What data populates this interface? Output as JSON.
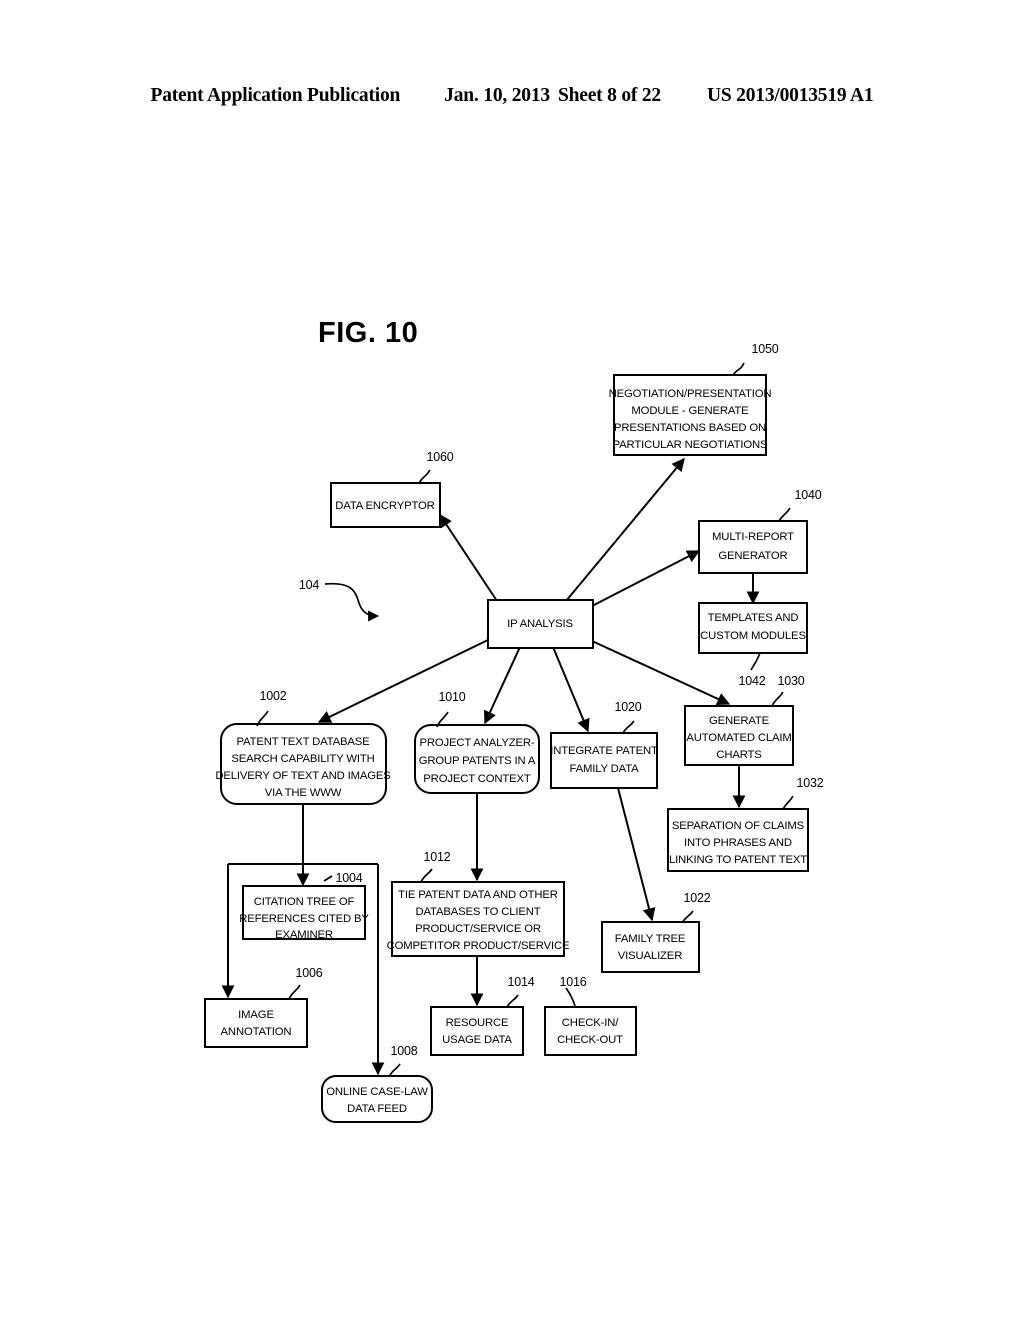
{
  "header": {
    "publication": "Patent Application Publication",
    "date": "Jan. 10, 2013",
    "sheet": "Sheet 8 of 22",
    "patent_number": "US 2013/0013519 A1"
  },
  "figure": {
    "title": "FIG. 10",
    "system_ref": "104"
  },
  "nodes": {
    "ip_analysis": {
      "ref": "",
      "label": "IP ANALYSIS",
      "shape": "rect"
    },
    "negotiation_module": {
      "ref": "1050",
      "label": "NEGOTIATION/PRESENTATION MODULE - GENERATE PRESENTATIONS BASED ON PARTICULAR NEGOTIATIONS",
      "shape": "rect",
      "lines": [
        "NEGOTIATION/PRESENTATION",
        "MODULE - GENERATE",
        "PRESENTATIONS BASED ON",
        "PARTICULAR NEGOTIATIONS"
      ]
    },
    "data_encryptor": {
      "ref": "1060",
      "label": "DATA ENCRYPTOR",
      "shape": "rect",
      "lines": [
        "DATA ENCRYPTOR"
      ]
    },
    "multi_report": {
      "ref": "1040",
      "label": "MULTI-REPORT GENERATOR",
      "shape": "rect",
      "lines": [
        "MULTI-REPORT",
        "GENERATOR"
      ]
    },
    "templates": {
      "ref": "1042",
      "label": "TEMPLATES AND CUSTOM MODULES",
      "shape": "rect",
      "lines": [
        "TEMPLATES AND",
        "CUSTOM MODULES"
      ]
    },
    "claim_charts": {
      "ref": "1030",
      "label": "GENERATE AUTOMATED CLAIM CHARTS",
      "shape": "rect",
      "lines": [
        "GENERATE",
        "AUTOMATED CLAIM",
        "CHARTS"
      ]
    },
    "separation_claims": {
      "ref": "1032",
      "label": "SEPARATION OF CLAIMS INTO PHRASES AND LINKING TO PATENT TEXT",
      "shape": "rect",
      "lines": [
        "SEPARATION OF CLAIMS",
        "INTO PHRASES AND",
        "LINKING TO PATENT TEXT"
      ]
    },
    "patent_text_db": {
      "ref": "1002",
      "label": "PATENT TEXT DATABASE SEARCH CAPABILITY WITH DELIVERY OF TEXT AND IMAGES VIA THE WWW",
      "shape": "rounded",
      "lines": [
        "PATENT TEXT DATABASE",
        "SEARCH CAPABILITY WITH",
        "DELIVERY OF TEXT AND IMAGES",
        "VIA THE WWW"
      ]
    },
    "project_analyzer": {
      "ref": "1010",
      "label": "PROJECT ANALYZER-GROUP PATENTS IN A PROJECT CONTEXT",
      "shape": "rounded",
      "lines": [
        "PROJECT ANALYZER-",
        "GROUP PATENTS IN A",
        "PROJECT CONTEXT"
      ]
    },
    "integrate_family": {
      "ref": "1020",
      "label": "INTEGRATE PATENT FAMILY DATA",
      "shape": "rect",
      "lines": [
        "INTEGRATE PATENT",
        "FAMILY DATA"
      ]
    },
    "citation_tree": {
      "ref": "1004",
      "label": "CITATION TREE OF REFERENCES CITED BY EXAMINER",
      "shape": "rect",
      "lines": [
        "CITATION TREE OF",
        "REFERENCES CITED BY",
        "EXAMINER"
      ]
    },
    "tie_patent_data": {
      "ref": "1012",
      "label": "TIE PATENT DATA AND OTHER DATABASES TO CLIENT PRODUCT/SERVICE OR COMPETITOR PRODUCT/SERVICE",
      "shape": "rect",
      "lines": [
        "TIE PATENT DATA AND OTHER",
        "DATABASES TO CLIENT",
        "PRODUCT/SERVICE OR",
        "COMPETITOR PRODUCT/SERVICE"
      ]
    },
    "family_tree_vis": {
      "ref": "1022",
      "label": "FAMILY TREE VISUALIZER",
      "shape": "rect",
      "lines": [
        "FAMILY TREE",
        "VISUALIZER"
      ]
    },
    "image_annotation": {
      "ref": "1006",
      "label": "IMAGE ANNOTATION",
      "shape": "rect",
      "lines": [
        "IMAGE",
        "ANNOTATION"
      ]
    },
    "resource_usage": {
      "ref": "1014",
      "label": "RESOURCE USAGE DATA",
      "shape": "rect",
      "lines": [
        "RESOURCE",
        "USAGE DATA"
      ]
    },
    "check_in_out": {
      "ref": "1016",
      "label": "CHECK-IN/ CHECK-OUT",
      "shape": "rect",
      "lines": [
        "CHECK-IN/",
        "CHECK-OUT"
      ]
    },
    "online_case_law": {
      "ref": "1008",
      "label": "ONLINE CASE-LAW DATA FEED",
      "shape": "rounded",
      "lines": [
        "ONLINE CASE-LAW",
        "DATA FEED"
      ]
    }
  },
  "colors": {
    "stroke": "#000000",
    "fill": "#ffffff",
    "text": "#000000"
  }
}
